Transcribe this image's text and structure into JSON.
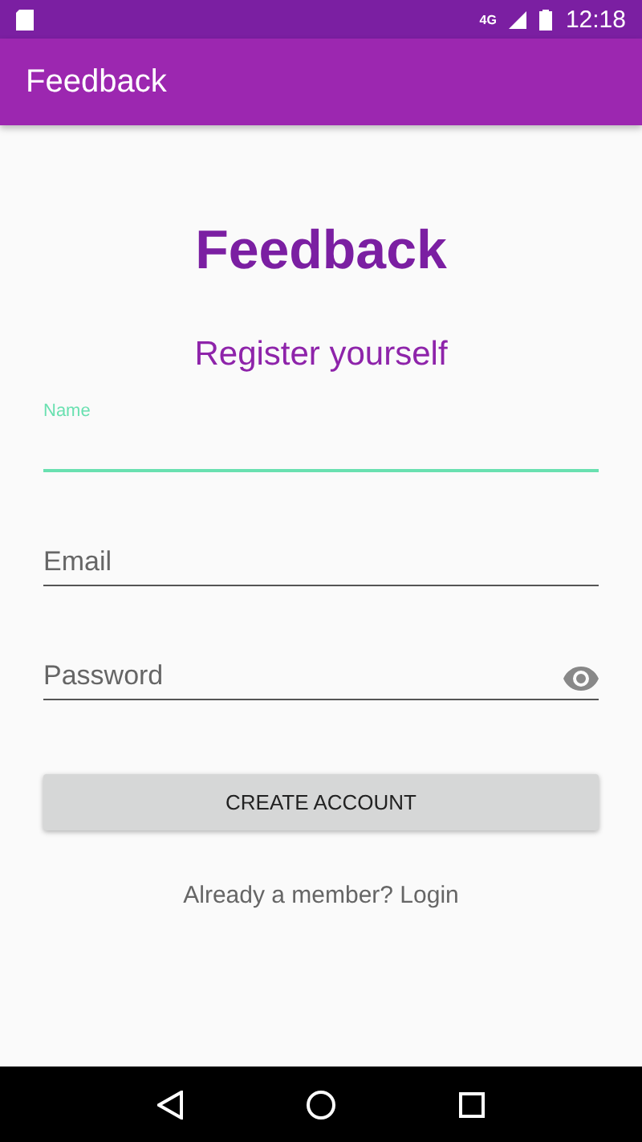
{
  "status_bar": {
    "network": "4G",
    "time": "12:18"
  },
  "app_bar": {
    "title": "Feedback"
  },
  "heading": "Feedback",
  "subheading": "Register yourself",
  "fields": [
    {
      "label": "Name",
      "focused": true,
      "kind": "text"
    },
    {
      "label": "Email",
      "focused": false,
      "kind": "text"
    },
    {
      "label": "Password",
      "focused": false,
      "kind": "password"
    }
  ],
  "button": "CREATE ACCOUNT",
  "login_link": "Already a member? Login"
}
